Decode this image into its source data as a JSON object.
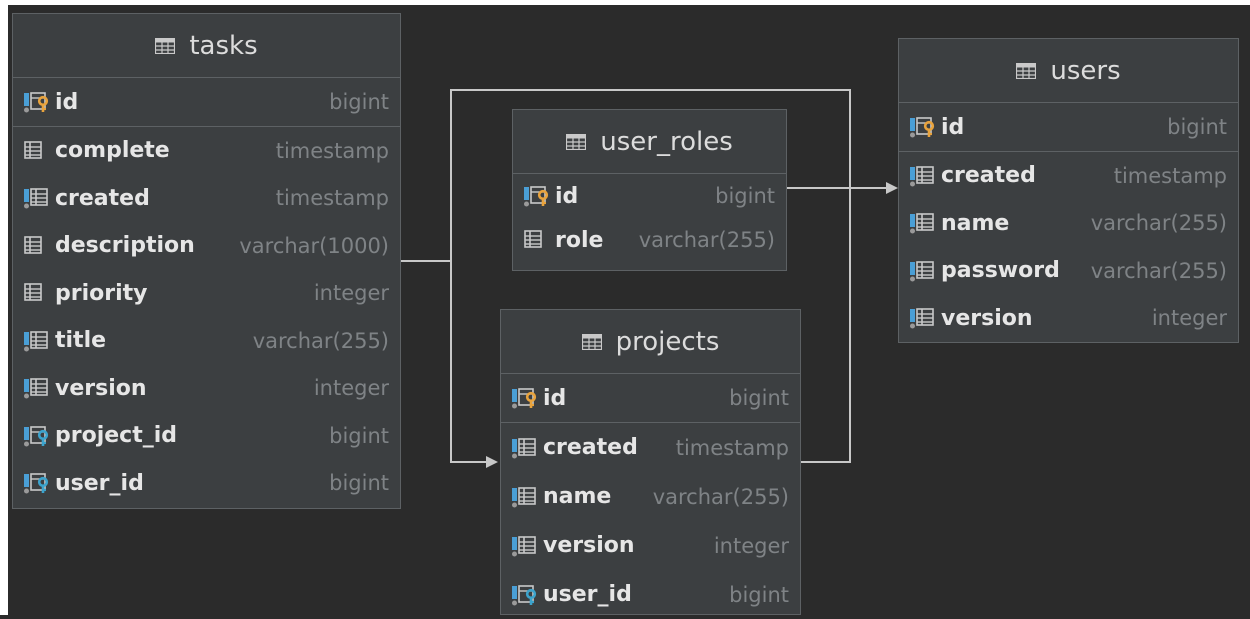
{
  "tables": {
    "tasks": {
      "name": "tasks",
      "pk": {
        "name": "id",
        "type": "bigint"
      },
      "columns": [
        {
          "name": "complete",
          "type": "timestamp",
          "icon": "column-icon"
        },
        {
          "name": "created",
          "type": "timestamp",
          "icon": "column-notnull-icon"
        },
        {
          "name": "description",
          "type": "varchar(1000)",
          "icon": "column-icon"
        },
        {
          "name": "priority",
          "type": "integer",
          "icon": "column-icon"
        },
        {
          "name": "title",
          "type": "varchar(255)",
          "icon": "column-notnull-icon"
        },
        {
          "name": "version",
          "type": "integer",
          "icon": "column-notnull-icon"
        },
        {
          "name": "project_id",
          "type": "bigint",
          "icon": "foreign-key-icon"
        },
        {
          "name": "user_id",
          "type": "bigint",
          "icon": "foreign-key-icon"
        }
      ]
    },
    "user_roles": {
      "name": "user_roles",
      "pk": {
        "name": "id",
        "type": "bigint"
      },
      "columns": [
        {
          "name": "role",
          "type": "varchar(255)",
          "icon": "column-icon"
        }
      ]
    },
    "projects": {
      "name": "projects",
      "pk": {
        "name": "id",
        "type": "bigint"
      },
      "columns": [
        {
          "name": "created",
          "type": "timestamp",
          "icon": "column-notnull-icon"
        },
        {
          "name": "name",
          "type": "varchar(255)",
          "icon": "column-notnull-icon"
        },
        {
          "name": "version",
          "type": "integer",
          "icon": "column-notnull-icon"
        },
        {
          "name": "user_id",
          "type": "bigint",
          "icon": "foreign-key-icon"
        }
      ]
    },
    "users": {
      "name": "users",
      "pk": {
        "name": "id",
        "type": "bigint"
      },
      "columns": [
        {
          "name": "created",
          "type": "timestamp",
          "icon": "column-notnull-icon"
        },
        {
          "name": "name",
          "type": "varchar(255)",
          "icon": "column-notnull-icon"
        },
        {
          "name": "password",
          "type": "varchar(255)",
          "icon": "column-notnull-icon"
        },
        {
          "name": "version",
          "type": "integer",
          "icon": "column-notnull-icon"
        }
      ]
    }
  },
  "relationships": [
    {
      "from": "tasks",
      "to": "projects"
    },
    {
      "from": "projects",
      "to": "users"
    },
    {
      "from": "user_roles",
      "to": "users"
    }
  ],
  "colors": {
    "background": "#2b2b2b",
    "table_bg": "#3c3f41",
    "table_border": "#5d6164",
    "column_name": "#e6e6e6",
    "column_type": "#7f8386",
    "connector": "#c8c8c8",
    "pk_key": "#e8a33d",
    "fk_key": "#3ca3cc",
    "icon_blue": "#4a9fd6"
  }
}
